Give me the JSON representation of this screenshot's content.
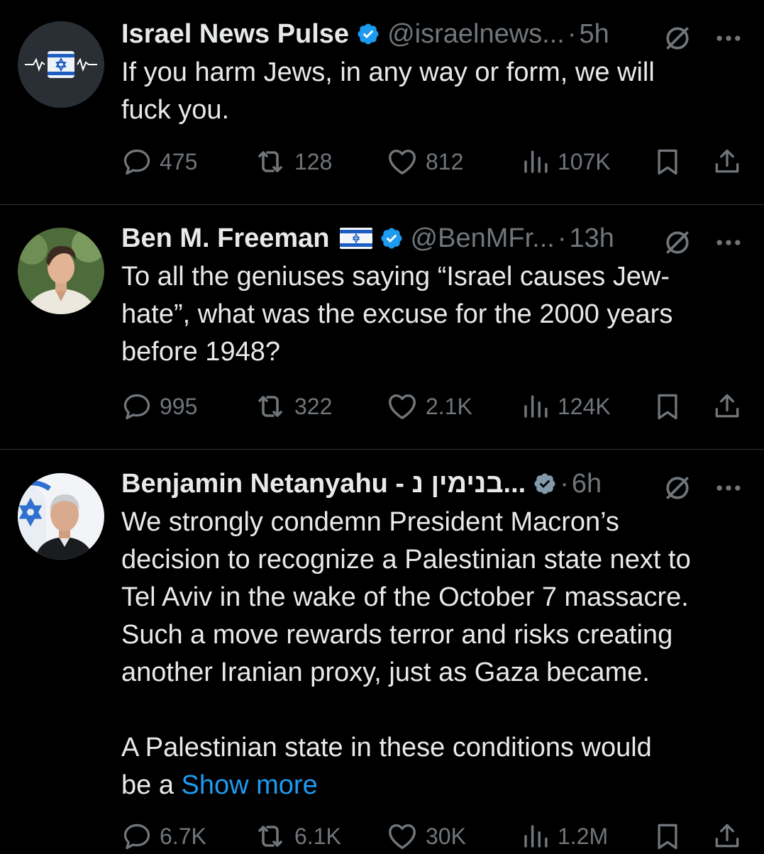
{
  "tweets": [
    {
      "name": "Israel News Pulse",
      "handle": "@israelnews...",
      "separator": "·",
      "time": "5h",
      "text": "If you harm Jews, in any way or form, we will\nfuck you.",
      "stats": {
        "replies": "475",
        "reposts": "128",
        "likes": "812",
        "views": "107K"
      },
      "verified_color": "#1d9bf0"
    },
    {
      "name": "Ben M. Freeman",
      "handle": "@BenMFr...",
      "separator": "·",
      "time": "13h",
      "text": "To all the geniuses saying “Israel causes Jew-\nhate”, what was the excuse for the 2000 years\nbefore 1948?",
      "stats": {
        "replies": "995",
        "reposts": "322",
        "likes": "2.1K",
        "views": "124K"
      },
      "flag": "israel-flag-icon"
    },
    {
      "name": "Benjamin Netanyahu - בנימין נ...",
      "separator": "·",
      "time": "6h",
      "text": "We strongly condemn President Macron’s\ndecision to recognize a Palestinian state next to\nTel Aviv in the wake of the October 7 massacre.\nSuch a move rewards terror and risks creating\nanother Iranian proxy, just as Gaza became.\n\nA Palestinian state in these conditions would\nbe a ",
      "show_more": "Show more",
      "stats": {
        "replies": "6.7K",
        "reposts": "6.1K",
        "likes": "30K",
        "views": "1.2M"
      }
    }
  ],
  "colors": {
    "background": "#000000",
    "text": "#e7e9ea",
    "muted": "#71767b",
    "accent": "#1d9bf0",
    "divider": "#2f3336"
  }
}
